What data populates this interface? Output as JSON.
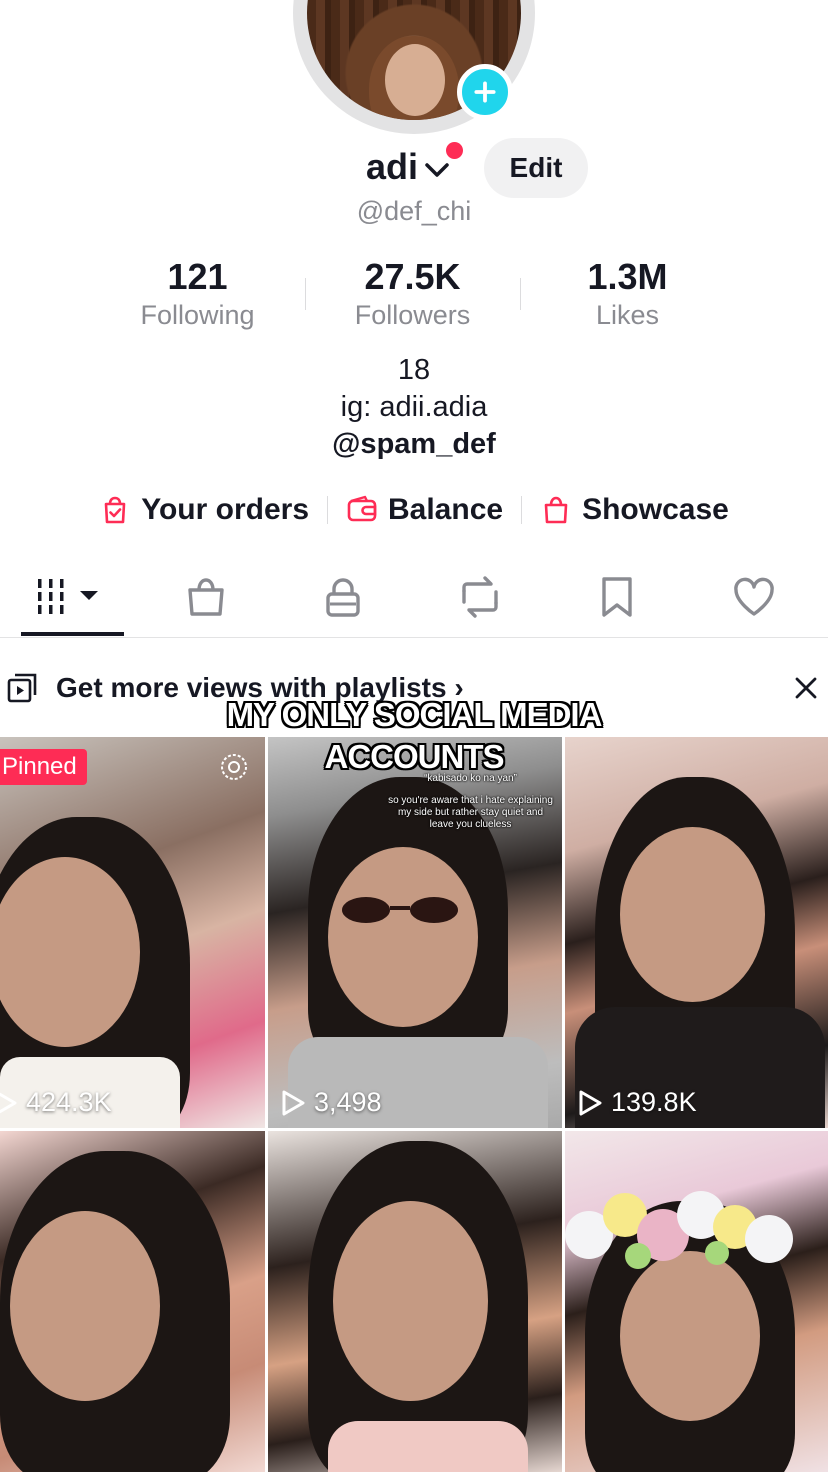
{
  "profile": {
    "display_name": "adi",
    "handle": "@def_chi",
    "edit_label": "Edit"
  },
  "stats": [
    {
      "value": "121",
      "label": "Following"
    },
    {
      "value": "27.5K",
      "label": "Followers"
    },
    {
      "value": "1.3M",
      "label": "Likes"
    }
  ],
  "bio": {
    "line1": "18",
    "line2": "ig: adii.adia",
    "line3": "@spam_def"
  },
  "shop": {
    "orders": "Your orders",
    "balance": "Balance",
    "showcase": "Showcase"
  },
  "tabs": [
    "videos-grid-icon",
    "shop-bag-icon",
    "lock-icon",
    "repost-icon",
    "bookmark-icon",
    "heart-icon"
  ],
  "playlist_banner": {
    "text": "Get more views with playlists ›"
  },
  "overlay_caption": {
    "line1": "MY ONLY SOCIAL MEDIA",
    "line2": "ACCOUNTS"
  },
  "videos": [
    {
      "views": "424.3K",
      "pinned_label": "Pinned"
    },
    {
      "views": "3,498",
      "caption_quote": "“kabisado ko na yan”",
      "caption_text": "so you're aware that i hate explaining my side but rather stay quiet and leave you clueless"
    },
    {
      "views": "139.8K"
    }
  ],
  "colors": {
    "accent_red": "#fe2c55",
    "accent_cyan": "#20d5ec",
    "text_primary": "#161823",
    "text_secondary": "#8a8b91"
  }
}
